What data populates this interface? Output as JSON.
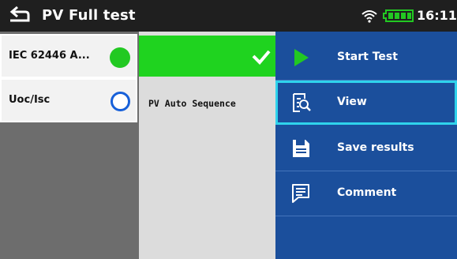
{
  "header": {
    "title": "PV Full test",
    "time": "16:11",
    "icons": [
      "back-icon",
      "wifi-icon",
      "battery-icon"
    ]
  },
  "test_list": {
    "items": [
      {
        "label": "IEC 62446 A...",
        "status": "passed",
        "status_color": "#22c922"
      },
      {
        "label": "Uoc/Isc",
        "status": "not-started",
        "status_color": "#1760d9"
      }
    ]
  },
  "details": {
    "result_bar_color": "#1fd31f",
    "sequence_label": "PV Auto Sequence"
  },
  "menu": {
    "items": [
      {
        "label": "Start Test",
        "icon": "play-icon"
      },
      {
        "label": "View",
        "icon": "view-icon",
        "selected": true
      },
      {
        "label": "Save results",
        "icon": "save-icon"
      },
      {
        "label": "Comment",
        "icon": "comment-icon"
      }
    ],
    "background": "#1b4f9c",
    "highlight": "#2fd3ec"
  }
}
